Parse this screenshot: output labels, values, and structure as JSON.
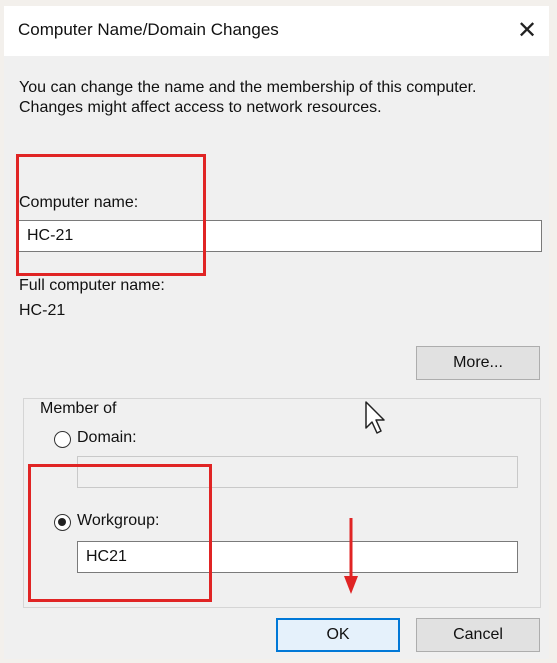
{
  "window": {
    "title": "Computer Name/Domain Changes",
    "close_glyph": "✕"
  },
  "description": "You can change the name and the membership of this computer. Changes might affect access to network resources.",
  "computer_name": {
    "label": "Computer name:",
    "value": "HC-21"
  },
  "full_computer_name": {
    "label": "Full computer name:",
    "value": "HC-21"
  },
  "buttons": {
    "more": "More...",
    "ok": "OK",
    "cancel": "Cancel"
  },
  "member_of": {
    "legend": "Member of",
    "domain_label": "Domain:",
    "domain_value": "",
    "domain_selected": false,
    "workgroup_label": "Workgroup:",
    "workgroup_value": "HC21",
    "workgroup_selected": true
  },
  "annotation_color": "#e02424"
}
